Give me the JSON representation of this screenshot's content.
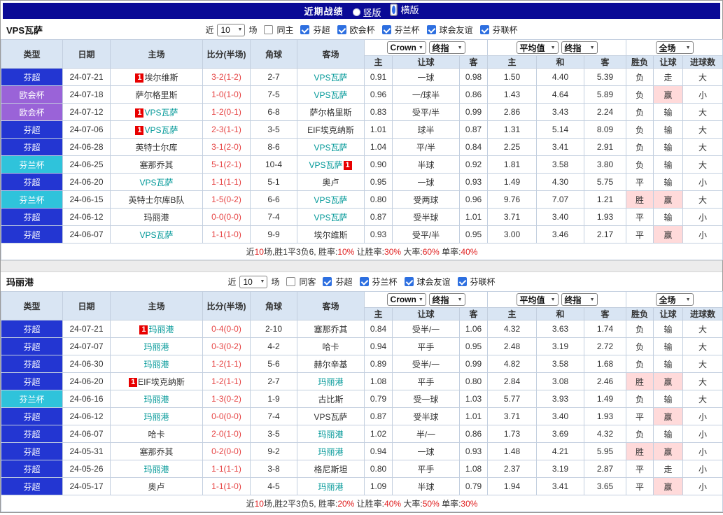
{
  "top_bar": {
    "title": "近期战绩",
    "radios": [
      {
        "label": "竖版",
        "selected": false
      },
      {
        "label": "横版",
        "selected": true
      }
    ]
  },
  "table_header": {
    "static_cols": [
      "类型",
      "日期",
      "主场",
      "比分(半场)",
      "角球",
      "客场"
    ],
    "odds_selects": [
      "Crown",
      "终指"
    ],
    "avg_selects": [
      "平均值",
      "终指"
    ],
    "full_select": [
      "全场"
    ],
    "sub_cols": [
      "主",
      "让球",
      "客",
      "主",
      "和",
      "客",
      "胜负",
      "让球",
      "进球数"
    ]
  },
  "league_colors": {
    "芬超": "#2336d2",
    "欧会杯": "#9a63d8",
    "芬兰杯": "#2fc3db"
  },
  "sections": [
    {
      "team": "VPS瓦萨",
      "filter": {
        "prefix": "近",
        "count": "10",
        "suffix": "场",
        "same_label": "同主",
        "same_checked": false,
        "leagues": [
          {
            "label": "芬超",
            "checked": true
          },
          {
            "label": "欧会杯",
            "checked": true
          },
          {
            "label": "芬兰杯",
            "checked": true
          },
          {
            "label": "球会友谊",
            "checked": true
          },
          {
            "label": "芬联杯",
            "checked": true
          }
        ]
      },
      "rows": [
        {
          "league": "芬超",
          "date": "24-07-21",
          "home": "埃尔维斯",
          "home_badge": "1",
          "home_self": false,
          "score": "3-2(1-2)",
          "corners": "2-7",
          "away": "VPS瓦萨",
          "away_self": true,
          "odds_home": "0.91",
          "handicap": "一球",
          "odds_away": "0.98",
          "avg_home": "1.50",
          "avg_draw": "4.40",
          "avg_away": "5.39",
          "result": "负",
          "handicap_result": "走",
          "goals": "大"
        },
        {
          "league": "欧会杯",
          "date": "24-07-18",
          "home": "萨尔格里斯",
          "home_self": false,
          "score": "1-0(1-0)",
          "corners": "7-5",
          "away": "VPS瓦萨",
          "away_self": true,
          "odds_home": "0.96",
          "handicap": "一/球半",
          "odds_away": "0.86",
          "avg_home": "1.43",
          "avg_draw": "4.64",
          "avg_away": "5.89",
          "result": "负",
          "handicap_result": "赢",
          "goals": "小"
        },
        {
          "league": "欧会杯",
          "date": "24-07-12",
          "home": "VPS瓦萨",
          "home_badge": "1",
          "home_self": true,
          "score": "1-2(0-1)",
          "corners": "6-8",
          "away": "萨尔格里斯",
          "away_self": false,
          "odds_home": "0.83",
          "handicap": "受平/半",
          "odds_away": "0.99",
          "avg_home": "2.86",
          "avg_draw": "3.43",
          "avg_away": "2.24",
          "result": "负",
          "handicap_result": "输",
          "goals": "大"
        },
        {
          "league": "芬超",
          "date": "24-07-06",
          "home": "VPS瓦萨",
          "home_badge": "1",
          "home_self": true,
          "score": "2-3(1-1)",
          "corners": "3-5",
          "away": "EIF埃克纳斯",
          "away_self": false,
          "odds_home": "1.01",
          "handicap": "球半",
          "odds_away": "0.87",
          "avg_home": "1.31",
          "avg_draw": "5.14",
          "avg_away": "8.09",
          "result": "负",
          "handicap_result": "输",
          "goals": "大"
        },
        {
          "league": "芬超",
          "date": "24-06-28",
          "home": "英特士尔库",
          "home_self": false,
          "score": "3-1(2-0)",
          "corners": "8-6",
          "away": "VPS瓦萨",
          "away_self": true,
          "odds_home": "1.04",
          "handicap": "平/半",
          "odds_away": "0.84",
          "avg_home": "2.25",
          "avg_draw": "3.41",
          "avg_away": "2.91",
          "result": "负",
          "handicap_result": "输",
          "goals": "大"
        },
        {
          "league": "芬兰杯",
          "date": "24-06-25",
          "home": "塞那乔其",
          "home_self": false,
          "score": "5-1(2-1)",
          "corners": "10-4",
          "away": "VPS瓦萨",
          "away_badge": "1",
          "away_badge_after": true,
          "away_self": true,
          "odds_home": "0.90",
          "handicap": "半球",
          "odds_away": "0.92",
          "avg_home": "1.81",
          "avg_draw": "3.58",
          "avg_away": "3.80",
          "result": "负",
          "handicap_result": "输",
          "goals": "大"
        },
        {
          "league": "芬超",
          "date": "24-06-20",
          "home": "VPS瓦萨",
          "home_self": true,
          "score": "1-1(1-1)",
          "corners": "5-1",
          "away": "奥卢",
          "away_self": false,
          "odds_home": "0.95",
          "handicap": "一球",
          "odds_away": "0.93",
          "avg_home": "1.49",
          "avg_draw": "4.30",
          "avg_away": "5.75",
          "result": "平",
          "handicap_result": "输",
          "goals": "小"
        },
        {
          "league": "芬兰杯",
          "date": "24-06-15",
          "home": "英特士尔库B队",
          "home_self": false,
          "score": "1-5(0-2)",
          "corners": "6-6",
          "away": "VPS瓦萨",
          "away_self": true,
          "odds_home": "0.80",
          "handicap": "受两球",
          "odds_away": "0.96",
          "avg_home": "9.76",
          "avg_draw": "7.07",
          "avg_away": "1.21",
          "result": "胜",
          "handicap_result": "赢",
          "goals": "大"
        },
        {
          "league": "芬超",
          "date": "24-06-12",
          "home": "玛丽港",
          "home_self": false,
          "score": "0-0(0-0)",
          "corners": "7-4",
          "away": "VPS瓦萨",
          "away_self": true,
          "odds_home": "0.87",
          "handicap": "受半球",
          "odds_away": "1.01",
          "avg_home": "3.71",
          "avg_draw": "3.40",
          "avg_away": "1.93",
          "result": "平",
          "handicap_result": "输",
          "goals": "小"
        },
        {
          "league": "芬超",
          "date": "24-06-07",
          "home": "VPS瓦萨",
          "home_self": true,
          "score": "1-1(1-0)",
          "corners": "9-9",
          "away": "埃尔维斯",
          "away_self": false,
          "odds_home": "0.93",
          "handicap": "受平/半",
          "odds_away": "0.95",
          "avg_home": "3.00",
          "avg_draw": "3.46",
          "avg_away": "2.17",
          "result": "平",
          "handicap_result": "赢",
          "goals": "小"
        }
      ],
      "summary": [
        {
          "text": "近",
          "red": false
        },
        {
          "text": "10",
          "red": true
        },
        {
          "text": "场,胜1平3负6, 胜率:",
          "red": false
        },
        {
          "text": "10%",
          "red": true
        },
        {
          "text": " 让胜率:",
          "red": false
        },
        {
          "text": "30%",
          "red": true
        },
        {
          "text": " 大率:",
          "red": false
        },
        {
          "text": "60%",
          "red": true
        },
        {
          "text": " 单率:",
          "red": false
        },
        {
          "text": "40%",
          "red": true
        }
      ]
    },
    {
      "team": "玛丽港",
      "filter": {
        "prefix": "近",
        "count": "10",
        "suffix": "场",
        "same_label": "同客",
        "same_checked": false,
        "leagues": [
          {
            "label": "芬超",
            "checked": true
          },
          {
            "label": "芬兰杯",
            "checked": true
          },
          {
            "label": "球会友谊",
            "checked": true
          },
          {
            "label": "芬联杯",
            "checked": true
          }
        ]
      },
      "rows": [
        {
          "league": "芬超",
          "date": "24-07-21",
          "home": "玛丽港",
          "home_badge": "1",
          "home_self": true,
          "score": "0-4(0-0)",
          "corners": "2-10",
          "away": "塞那乔其",
          "away_self": false,
          "odds_home": "0.84",
          "handicap": "受半/一",
          "odds_away": "1.06",
          "avg_home": "4.32",
          "avg_draw": "3.63",
          "avg_away": "1.74",
          "result": "负",
          "handicap_result": "输",
          "goals": "大"
        },
        {
          "league": "芬超",
          "date": "24-07-07",
          "home": "玛丽港",
          "home_self": true,
          "score": "0-3(0-2)",
          "corners": "4-2",
          "away": "哈卡",
          "away_self": false,
          "odds_home": "0.94",
          "handicap": "平手",
          "odds_away": "0.95",
          "avg_home": "2.48",
          "avg_draw": "3.19",
          "avg_away": "2.72",
          "result": "负",
          "handicap_result": "输",
          "goals": "大"
        },
        {
          "league": "芬超",
          "date": "24-06-30",
          "home": "玛丽港",
          "home_self": true,
          "score": "1-2(1-1)",
          "corners": "5-6",
          "away": "赫尔辛基",
          "away_self": false,
          "odds_home": "0.89",
          "handicap": "受半/一",
          "odds_away": "0.99",
          "avg_home": "4.82",
          "avg_draw": "3.58",
          "avg_away": "1.68",
          "result": "负",
          "handicap_result": "输",
          "goals": "大"
        },
        {
          "league": "芬超",
          "date": "24-06-20",
          "home": "EIF埃克纳斯",
          "home_badge": "1",
          "home_self": false,
          "score": "1-2(1-1)",
          "corners": "2-7",
          "away": "玛丽港",
          "away_self": true,
          "odds_home": "1.08",
          "handicap": "平手",
          "odds_away": "0.80",
          "avg_home": "2.84",
          "avg_draw": "3.08",
          "avg_away": "2.46",
          "result": "胜",
          "handicap_result": "赢",
          "goals": "大"
        },
        {
          "league": "芬兰杯",
          "date": "24-06-16",
          "home": "玛丽港",
          "home_self": true,
          "score": "1-3(0-2)",
          "corners": "1-9",
          "away": "古比斯",
          "away_self": false,
          "odds_home": "0.79",
          "handicap": "受一球",
          "odds_away": "1.03",
          "avg_home": "5.77",
          "avg_draw": "3.93",
          "avg_away": "1.49",
          "result": "负",
          "handicap_result": "输",
          "goals": "大"
        },
        {
          "league": "芬超",
          "date": "24-06-12",
          "home": "玛丽港",
          "home_self": true,
          "score": "0-0(0-0)",
          "corners": "7-4",
          "away": "VPS瓦萨",
          "away_self": false,
          "odds_home": "0.87",
          "handicap": "受半球",
          "odds_away": "1.01",
          "avg_home": "3.71",
          "avg_draw": "3.40",
          "avg_away": "1.93",
          "result": "平",
          "handicap_result": "赢",
          "goals": "小"
        },
        {
          "league": "芬超",
          "date": "24-06-07",
          "home": "哈卡",
          "home_self": false,
          "score": "2-0(1-0)",
          "corners": "3-5",
          "away": "玛丽港",
          "away_self": true,
          "odds_home": "1.02",
          "handicap": "半/一",
          "odds_away": "0.86",
          "avg_home": "1.73",
          "avg_draw": "3.69",
          "avg_away": "4.32",
          "result": "负",
          "handicap_result": "输",
          "goals": "小"
        },
        {
          "league": "芬超",
          "date": "24-05-31",
          "home": "塞那乔其",
          "home_self": false,
          "score": "0-2(0-0)",
          "corners": "9-2",
          "away": "玛丽港",
          "away_self": true,
          "odds_home": "0.94",
          "handicap": "一球",
          "odds_away": "0.93",
          "avg_home": "1.48",
          "avg_draw": "4.21",
          "avg_away": "5.95",
          "result": "胜",
          "handicap_result": "赢",
          "goals": "小"
        },
        {
          "league": "芬超",
          "date": "24-05-26",
          "home": "玛丽港",
          "home_self": true,
          "score": "1-1(1-1)",
          "corners": "3-8",
          "away": "格尼斯坦",
          "away_self": false,
          "odds_home": "0.80",
          "handicap": "平手",
          "odds_away": "1.08",
          "avg_home": "2.37",
          "avg_draw": "3.19",
          "avg_away": "2.87",
          "result": "平",
          "handicap_result": "走",
          "goals": "小"
        },
        {
          "league": "芬超",
          "date": "24-05-17",
          "home": "奥卢",
          "home_self": false,
          "score": "1-1(1-0)",
          "corners": "4-5",
          "away": "玛丽港",
          "away_self": true,
          "odds_home": "1.09",
          "handicap": "半球",
          "odds_away": "0.79",
          "avg_home": "1.94",
          "avg_draw": "3.41",
          "avg_away": "3.65",
          "result": "平",
          "handicap_result": "赢",
          "goals": "小"
        }
      ],
      "summary": [
        {
          "text": "近",
          "red": false
        },
        {
          "text": "10",
          "red": true
        },
        {
          "text": "场,胜2平3负5, 胜率:",
          "red": false
        },
        {
          "text": "20%",
          "red": true
        },
        {
          "text": " 让胜率:",
          "red": false
        },
        {
          "text": "40%",
          "red": true
        },
        {
          "text": " 大率:",
          "red": false
        },
        {
          "text": "50%",
          "red": true
        },
        {
          "text": " 单率:",
          "red": false
        },
        {
          "text": "30%",
          "red": true
        }
      ]
    }
  ]
}
